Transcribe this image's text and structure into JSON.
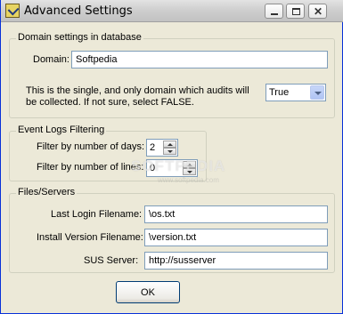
{
  "window": {
    "title": "Advanced Settings"
  },
  "domain_group": {
    "legend": "Domain settings in database",
    "domain_label": "Domain:",
    "domain_value": "Softpedia",
    "note_line1": "This is the single, and only domain which audits will",
    "note_line2": "be collected.  If not sure, select FALSE.",
    "select_value": "True"
  },
  "event_group": {
    "legend": "Event Logs Filtering",
    "days_label": "Filter by number of days:",
    "days_value": "2",
    "lines_label": "Filter by number of lines:",
    "lines_value": "0"
  },
  "files_group": {
    "legend": "Files/Servers",
    "login_label": "Last Login Filename:",
    "login_value": "\\os.txt",
    "version_label": "Install Version Filename:",
    "version_value": "\\version.txt",
    "sus_label": "SUS Server:",
    "sus_value": "http://susserver"
  },
  "buttons": {
    "ok": "OK"
  },
  "watermark": {
    "text": "SOFTPEDIA",
    "sub": "www.softpedia.com"
  },
  "icons": {
    "app": "app-icon",
    "minimize": "minimize-icon",
    "maximize": "maximize-icon",
    "close": "close-icon"
  }
}
